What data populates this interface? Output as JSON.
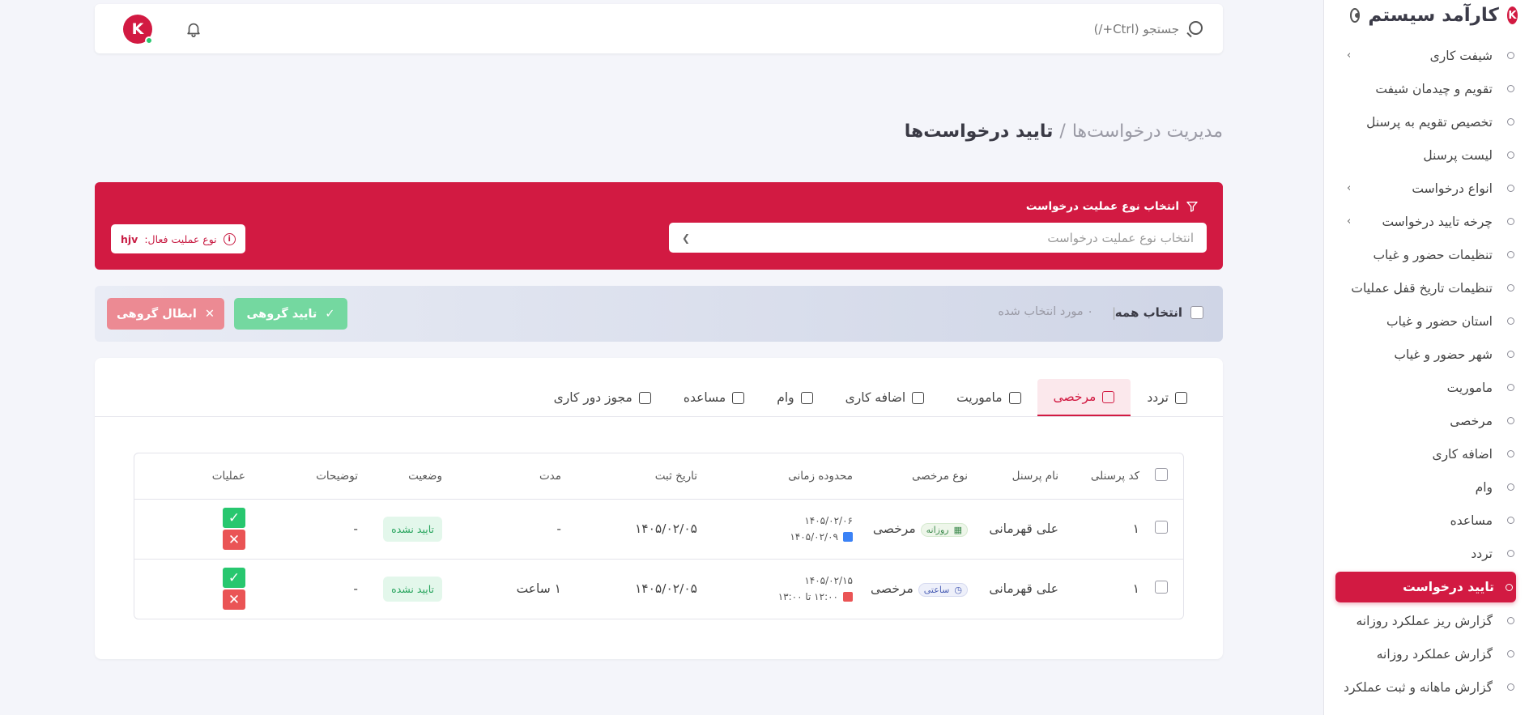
{
  "sidebar": {
    "logo_letter": "K",
    "title": "کارآمد سیستم",
    "items": [
      {
        "label": "شیفت کاری",
        "has_children": true
      },
      {
        "label": "تقویم و چیدمان شیفت",
        "has_children": false
      },
      {
        "label": "تخصیص تقویم به پرسنل",
        "has_children": false
      },
      {
        "label": "لیست پرسنل",
        "has_children": false
      },
      {
        "label": "انواع درخواست",
        "has_children": true
      },
      {
        "label": "چرخه تایید درخواست",
        "has_children": true
      },
      {
        "label": "تنظیمات حضور و غیاب",
        "has_children": false
      },
      {
        "label": "تنظیمات تاریخ قفل عملیات",
        "has_children": false
      },
      {
        "label": "استان حضور و غیاب",
        "has_children": false
      },
      {
        "label": "شهر حضور و غیاب",
        "has_children": false
      },
      {
        "label": "ماموریت",
        "has_children": false
      },
      {
        "label": "مرخصی",
        "has_children": false
      },
      {
        "label": "اضافه کاری",
        "has_children": false
      },
      {
        "label": "وام",
        "has_children": false
      },
      {
        "label": "مساعده",
        "has_children": false
      },
      {
        "label": "تردد",
        "has_children": false
      },
      {
        "label": "تایید درخواست",
        "has_children": false,
        "active": true
      },
      {
        "label": "گزارش ریز عملکرد روزانه",
        "has_children": false
      },
      {
        "label": "گزارش عملکرد روزانه",
        "has_children": false
      },
      {
        "label": "گزارش ماهانه و ثبت عملکرد",
        "has_children": false
      }
    ]
  },
  "topbar": {
    "search_placeholder": "جستجو (Ctrl+/)",
    "avatar_letter": "K"
  },
  "breadcrumb": {
    "parent": "مدیریت درخواست‌ها",
    "separator": "/",
    "current": "تایید درخواست‌ها"
  },
  "filter": {
    "label": "انتخاب نوع عملیت درخواست",
    "select_placeholder": "انتخاب نوع عملیت درخواست",
    "active_badge": "نوع عملیت فعال:",
    "active_value": "hjv"
  },
  "bulk": {
    "select_all": "انتخاب همه",
    "divider": "|",
    "selected_count": "۰ مورد انتخاب شده",
    "approve": "تایید گروهی",
    "cancel": "ابطال گروهی"
  },
  "tabs": [
    {
      "label": "تردد",
      "active": false
    },
    {
      "label": "مرخصی",
      "active": true
    },
    {
      "label": "ماموریت",
      "active": false
    },
    {
      "label": "اضافه کاری",
      "active": false
    },
    {
      "label": "وام",
      "active": false
    },
    {
      "label": "مساعده",
      "active": false
    },
    {
      "label": "مجوز دور کاری",
      "active": false
    }
  ],
  "table": {
    "headers": [
      "کد پرسنلی",
      "نام پرسنل",
      "نوع مرخصی",
      "محدوده زمانی",
      "تاریخ ثبت",
      "مدت",
      "وضعیت",
      "توضیحات",
      "عملیات"
    ],
    "rows": [
      {
        "code": "۱",
        "name": "علی قهرمانی",
        "type_chip": "روزانه",
        "type": "مرخصی",
        "range_top": "۱۴۰۵/۰۲/۰۶",
        "range_bottom": "۱۴۰۵/۰۲/۰۹",
        "date": "۱۴۰۵/۰۲/۰۵",
        "duration": "-",
        "status": "تایید نشده",
        "description": "-"
      },
      {
        "code": "۱",
        "name": "علی قهرمانی",
        "type_chip": "ساعتی",
        "type": "مرخصی",
        "range_top": "۱۴۰۵/۰۲/۱۵",
        "range_bottom": "۱۲:۰۰ تا ۱۳:۰۰",
        "date": "۱۴۰۵/۰۲/۰۵",
        "duration": "۱ ساعت",
        "status": "تایید نشده",
        "description": "-"
      }
    ]
  },
  "colors": {
    "brand": "#d21a42",
    "approve": "#28c76f",
    "reject": "#ea5455"
  }
}
